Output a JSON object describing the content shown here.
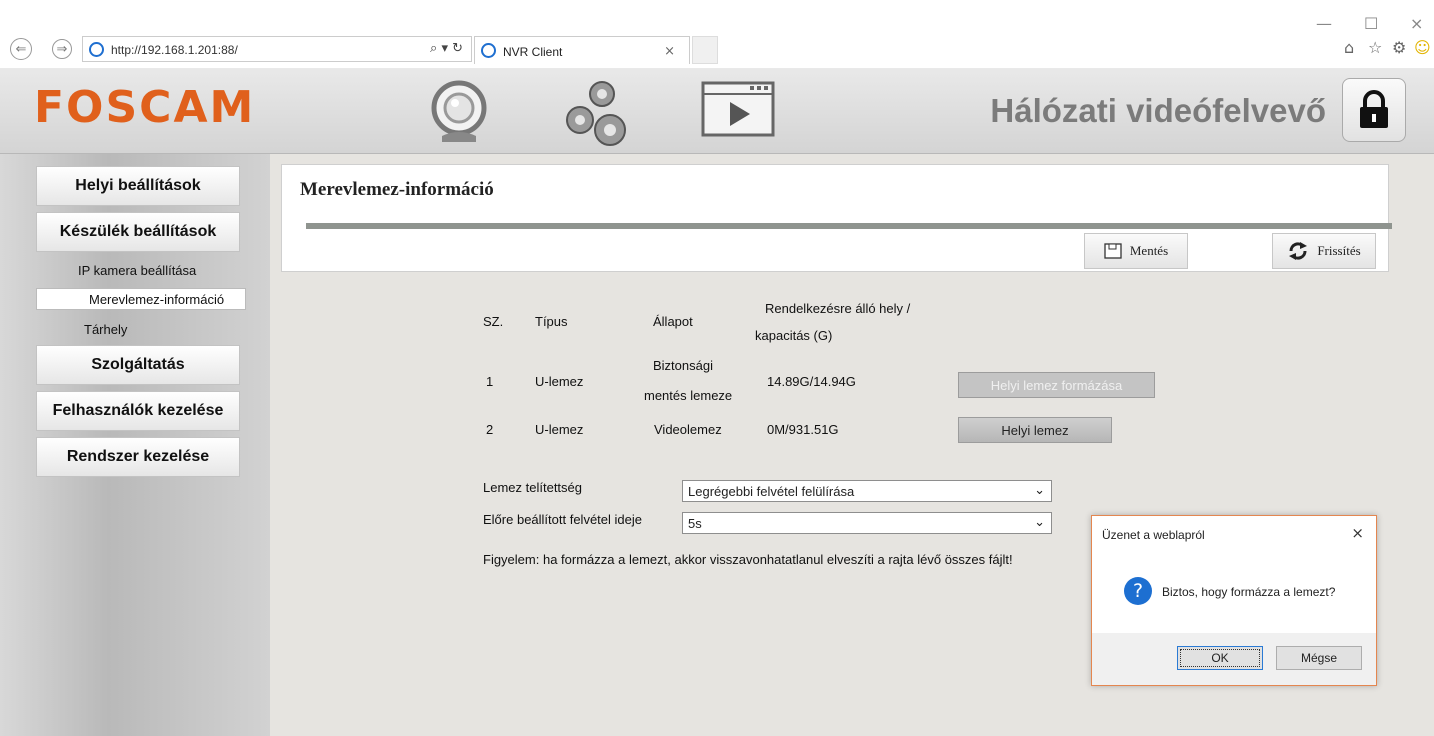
{
  "browser": {
    "url": "http://192.168.1.201:88/",
    "address_tools": "⌕ ▾ ↻",
    "tab_title": "NVR Client",
    "tab_close": "×",
    "win_min": "—",
    "win_max": "☐",
    "win_close": "×",
    "back_icon": "back-arrow-icon",
    "forward_icon": "forward-arrow-icon"
  },
  "header": {
    "logo": "FOSCAM",
    "app_title": "Hálózati videófelvevő",
    "nav_icons": [
      "camera-icon",
      "settings-gears-icon",
      "playback-icon"
    ],
    "accent": "#e0601c"
  },
  "sidebar": {
    "local_settings": "Helyi beállítások",
    "device_settings": "Készülék beállítások",
    "sub_ip_camera": "IP kamera beállítása",
    "sub_hdd_info": "Merevlemez-információ",
    "sub_storage": "Tárhely",
    "service": "Szolgáltatás",
    "user_mgmt": "Felhasználók kezelése",
    "system_mgmt": "Rendszer kezelése"
  },
  "panel": {
    "title": "Merevlemez-információ",
    "save_label": "Mentés",
    "refresh_label": "Frissítés"
  },
  "table": {
    "headers": {
      "no": "SZ.",
      "type": "Típus",
      "status": "Állapot",
      "capacity_line1": "Rendelkezésre álló hely /",
      "capacity_line2": "kapacitás (G)"
    },
    "rows": [
      {
        "no": "1",
        "type": "U-lemez",
        "status_line1": "Biztonsági",
        "status_line2": "mentés lemeze",
        "capacity": "14.89G/14.94G",
        "button": "Helyi lemez formázása"
      },
      {
        "no": "2",
        "type": "U-lemez",
        "status": "Videolemez",
        "capacity": "0M/931.51G",
        "button": "Helyi lemez"
      }
    ]
  },
  "settings": {
    "disk_full_label": "Lemez telítettség",
    "disk_full_value": "Legrégebbi felvétel felülírása",
    "prerecord_label": "Előre beállított felvétel ideje",
    "prerecord_value": "5s",
    "warning": "Figyelem: ha formázza a lemezt, akkor visszavonhatatlanul elveszíti a rajta lévő összes fájlt!"
  },
  "dialog": {
    "title": "Üzenet a weblapról",
    "message": "Biztos, hogy formázza a lemezt?",
    "icon": "question-icon",
    "ok": "OK",
    "cancel": "Mégse",
    "close": "×",
    "border_color": "#e4864f"
  }
}
